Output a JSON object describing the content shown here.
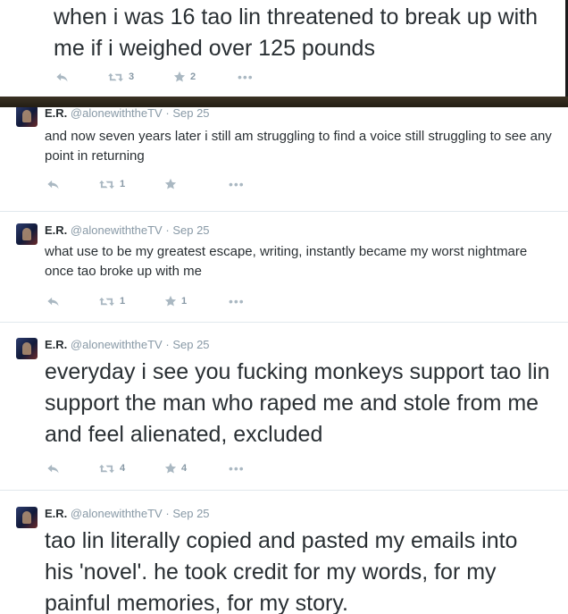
{
  "colors": {
    "text": "#292f33",
    "meta": "#8899a6",
    "action_icon": "#aab8c2",
    "divider": "#e1e8ed"
  },
  "top_tweet": {
    "text": "when i was 16 tao lin threatened to break up with me if i weighed over 125 pounds",
    "actions": {
      "retweets": "3",
      "favorites": "2"
    }
  },
  "tweets": [
    {
      "name": "E.R.",
      "handle": "@alonewiththeTV",
      "dot": "·",
      "time": "Sep 25",
      "text": "and now seven years later i still am struggling to find a voice still struggling to see any point in returning",
      "actions": {
        "retweets": "1",
        "favorites": ""
      }
    },
    {
      "name": "E.R.",
      "handle": "@alonewiththeTV",
      "dot": "·",
      "time": "Sep 25",
      "text": "what use to be my greatest escape, writing, instantly became my worst nightmare once tao broke up with me",
      "actions": {
        "retweets": "1",
        "favorites": "1"
      }
    },
    {
      "name": "E.R.",
      "handle": "@alonewiththeTV",
      "dot": "·",
      "time": "Sep 25",
      "text": "everyday i see you fucking monkeys support tao lin support the man who raped me and stole from me and feel alienated, excluded",
      "actions": {
        "retweets": "4",
        "favorites": "4"
      }
    },
    {
      "name": "E.R.",
      "handle": "@alonewiththeTV",
      "dot": "·",
      "time": "Sep 25",
      "text": "tao lin literally copied and pasted my emails into his 'novel'. he took credit for my words, for my painful memories, for my story."
    }
  ],
  "icons": {
    "reply": "reply-icon",
    "retweet": "retweet-icon",
    "favorite": "star-icon",
    "more": "more-icon",
    "more_glyph": "•••"
  }
}
